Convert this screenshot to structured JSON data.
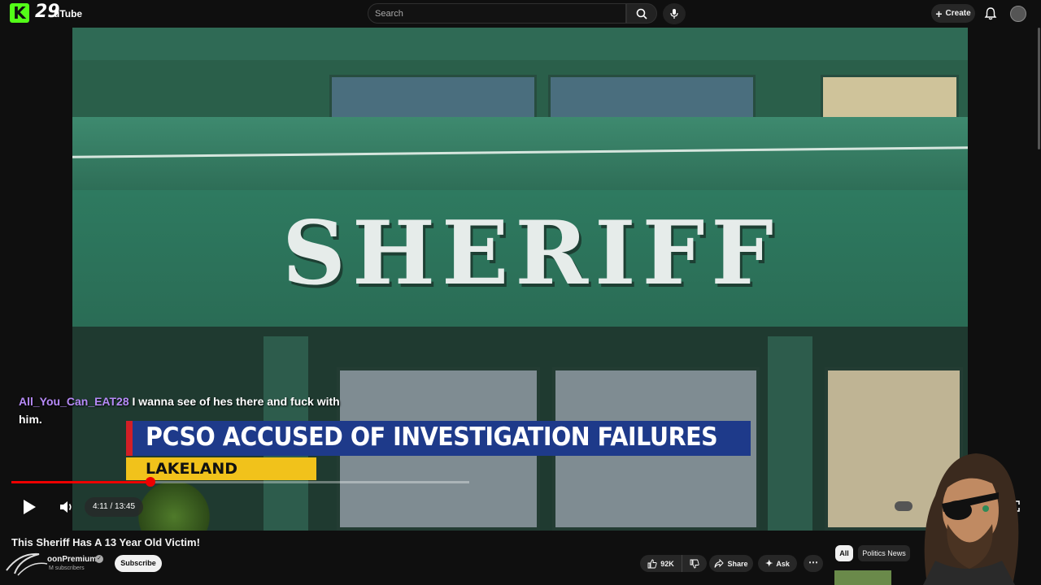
{
  "header": {
    "logo_k": "K",
    "logo_count": "29",
    "logo_suffix": "uTube",
    "search_placeholder": "Search",
    "create_label": "Create"
  },
  "video": {
    "sign_text": "SHERIFF",
    "headline": "PCSO ACCUSED OF INVESTIGATION FAILURES",
    "location": "LAKELAND"
  },
  "chat": {
    "username": "All_You_Can_EAT28",
    "message": "I wanna see of hes there and fuck with him."
  },
  "player": {
    "time": "4:11 / 13:45",
    "progress_fraction": 0.3043
  },
  "below": {
    "title": "This Sheriff Has A 13 Year Old Victim!",
    "channel_name": "oonPremium",
    "subscribers": "M subscribers",
    "subscribe_label": "Subscribe",
    "likes": "92K",
    "share_label": "Share",
    "ask_label": "Ask",
    "chips": [
      "All",
      "Politics News"
    ]
  },
  "colors": {
    "accent_red": "#ff0000",
    "kick_green": "#53fc18",
    "chat_user": "#b68af7"
  }
}
